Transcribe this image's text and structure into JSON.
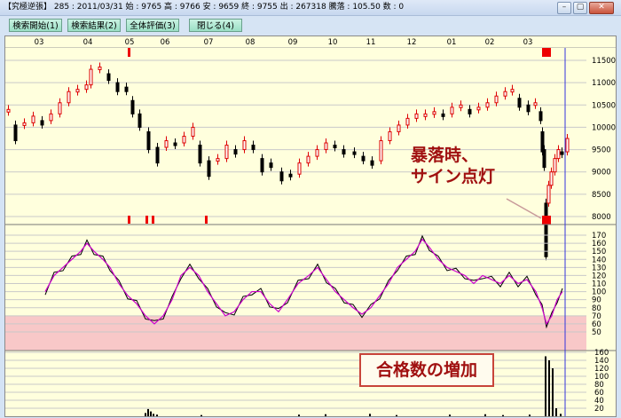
{
  "window": {
    "title": "【究極逆張】 285 : 2011/03/31  始 : 9765  高 : 9766  安 : 9659  終 : 9755  出 : 267318  騰落 : 105.50  数 : 0",
    "minimize": "–",
    "restore": "▢",
    "close": "✕"
  },
  "toolbar": {
    "start": "検索開始(1)",
    "result": "検索結果(2)",
    "evaluate": "全体評価(3)",
    "close": "閉じる(4)"
  },
  "chart": {
    "months": [
      "03",
      "04",
      "05",
      "06",
      "07",
      "08",
      "09",
      "10",
      "11",
      "12",
      "01",
      "02",
      "03"
    ],
    "price_ticks": [
      "11500",
      "11000",
      "10500",
      "10000",
      "9500",
      "9000",
      "8500",
      "8000"
    ],
    "osc_ticks": [
      "170",
      "160",
      "150",
      "140",
      "130",
      "120",
      "110",
      "100",
      "90",
      "80",
      "70",
      "60",
      "50"
    ],
    "vol_ticks": [
      "160",
      "140",
      "120",
      "100",
      "80",
      "60",
      "40",
      "20"
    ],
    "colors": {
      "up": "#dd0000",
      "down": "#000000",
      "signal": "#ee0000",
      "ma": "#cc00cc",
      "band": "#f8c8c8",
      "cursor": "#3333dd"
    }
  },
  "annotations": {
    "crash_line1": "暴落時、",
    "crash_line2": "サイン点灯",
    "increase": "合格数の増加"
  }
}
